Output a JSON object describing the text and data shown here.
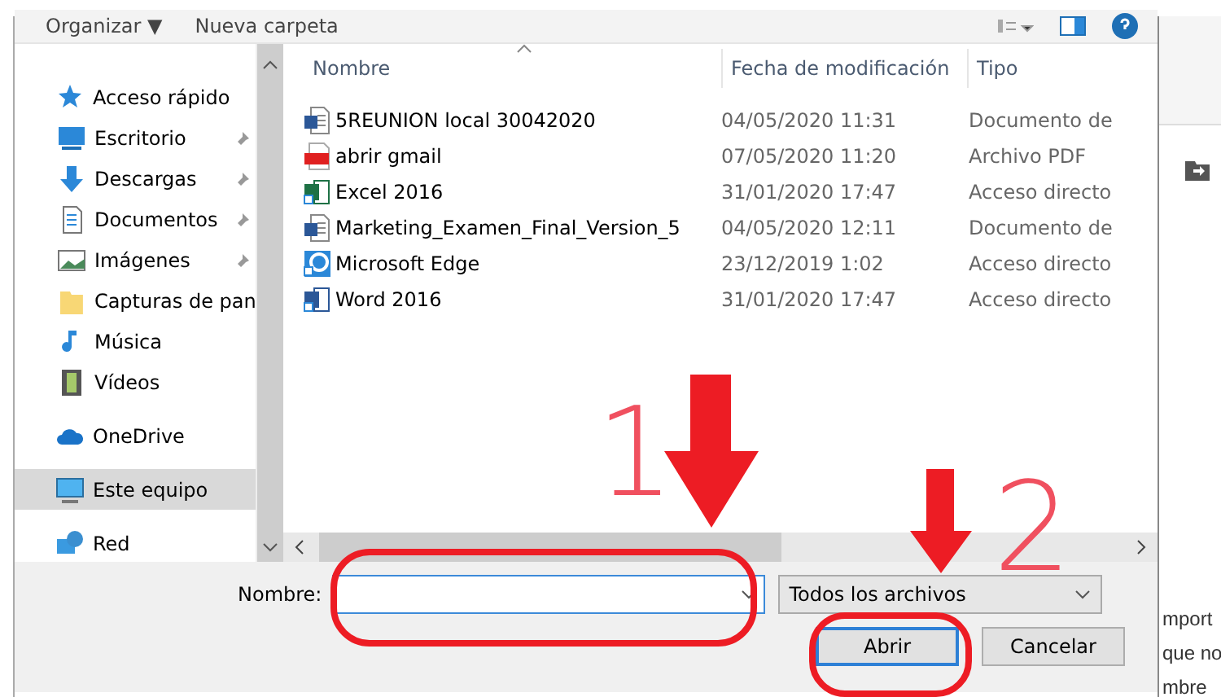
{
  "toolbar": {
    "organize": "Organizar ▼",
    "new_folder": "Nueva carpeta"
  },
  "navigation": [
    {
      "label": "Acceso rápido",
      "children": [
        {
          "label": "Escritorio",
          "pinned": true
        },
        {
          "label": "Descargas",
          "pinned": true
        },
        {
          "label": "Documentos",
          "pinned": true
        },
        {
          "label": "Imágenes",
          "pinned": true
        },
        {
          "label": "Capturas de pan",
          "pinned": false
        },
        {
          "label": "Música",
          "pinned": false
        },
        {
          "label": "Vídeos",
          "pinned": false
        }
      ]
    },
    {
      "label": "OneDrive",
      "selected": false
    },
    {
      "label": "Este equipo",
      "selected": true
    },
    {
      "label": "Red",
      "selected": false
    }
  ],
  "table": {
    "columns": [
      "Nombre",
      "Fecha de modificación",
      "Tipo"
    ],
    "rows": [
      {
        "kind": "word",
        "name": "5REUNION local 30042020",
        "date": "04/05/2020 11:31",
        "type": "Documento de"
      },
      {
        "kind": "pdf",
        "name": "abrir gmail",
        "date": "07/05/2020 11:20",
        "type": "Archivo PDF"
      },
      {
        "kind": "excel-link",
        "name": "Excel 2016",
        "date": "31/01/2020 17:47",
        "type": "Acceso directo"
      },
      {
        "kind": "word",
        "name": "Marketing_Examen_Final_Version_5",
        "date": "04/05/2020 12:11",
        "type": "Documento de"
      },
      {
        "kind": "edge-link",
        "name": "Microsoft Edge",
        "date": "23/12/2019 1:02",
        "type": "Acceso directo"
      },
      {
        "kind": "word-link",
        "name": "Word 2016",
        "date": "31/01/2020 17:47",
        "type": "Acceso directo"
      }
    ]
  },
  "footer": {
    "name_label": "Nombre:",
    "filter": "Todos los archivos",
    "buttons": [
      "Abrir",
      "Cancelar"
    ]
  },
  "annotations": [
    "1",
    "2"
  ],
  "background_text": [
    "mport",
    "que no",
    "mbre"
  ]
}
